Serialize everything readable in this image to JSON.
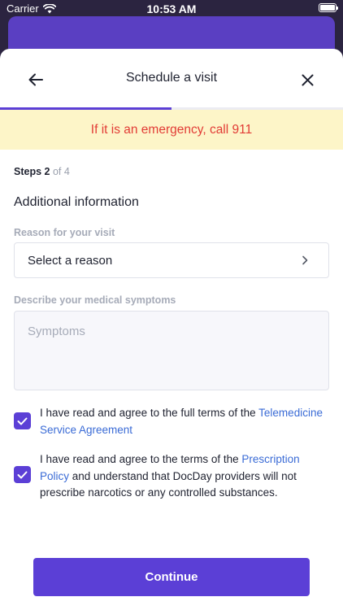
{
  "status_bar": {
    "carrier": "Carrier",
    "time": "10:53 AM"
  },
  "header": {
    "title": "Schedule a visit"
  },
  "progress": {
    "fraction": 0.5
  },
  "emergency_banner": "If it is an emergency, call 911",
  "steps": {
    "label": "Steps 2",
    "of": "of 4"
  },
  "section_title": "Additional information",
  "reason": {
    "label": "Reason for your visit",
    "placeholder": "Select a reason"
  },
  "symptoms": {
    "label": "Describe your medical symptoms",
    "placeholder": "Symptoms"
  },
  "agreements": [
    {
      "text_before": "I have read and agree to the full terms of the ",
      "link": "Telemedicine Service Agreement",
      "text_after": "",
      "checked": true
    },
    {
      "text_before": "I have read and agree to the terms of the ",
      "link": "Prescription Policy",
      "text_after": " and understand that DocDay providers will not prescribe narcotics or any controlled substances.",
      "checked": true
    }
  ],
  "continue_label": "Continue",
  "colors": {
    "accent": "#5b3fd6",
    "emergency_text": "#e23c36",
    "emergency_bg": "#fdf5c8",
    "link": "#3a6bd6"
  },
  "icons": {
    "back": "arrow-left-icon",
    "close": "close-icon",
    "chevron": "chevron-right-icon",
    "check": "check-icon"
  }
}
